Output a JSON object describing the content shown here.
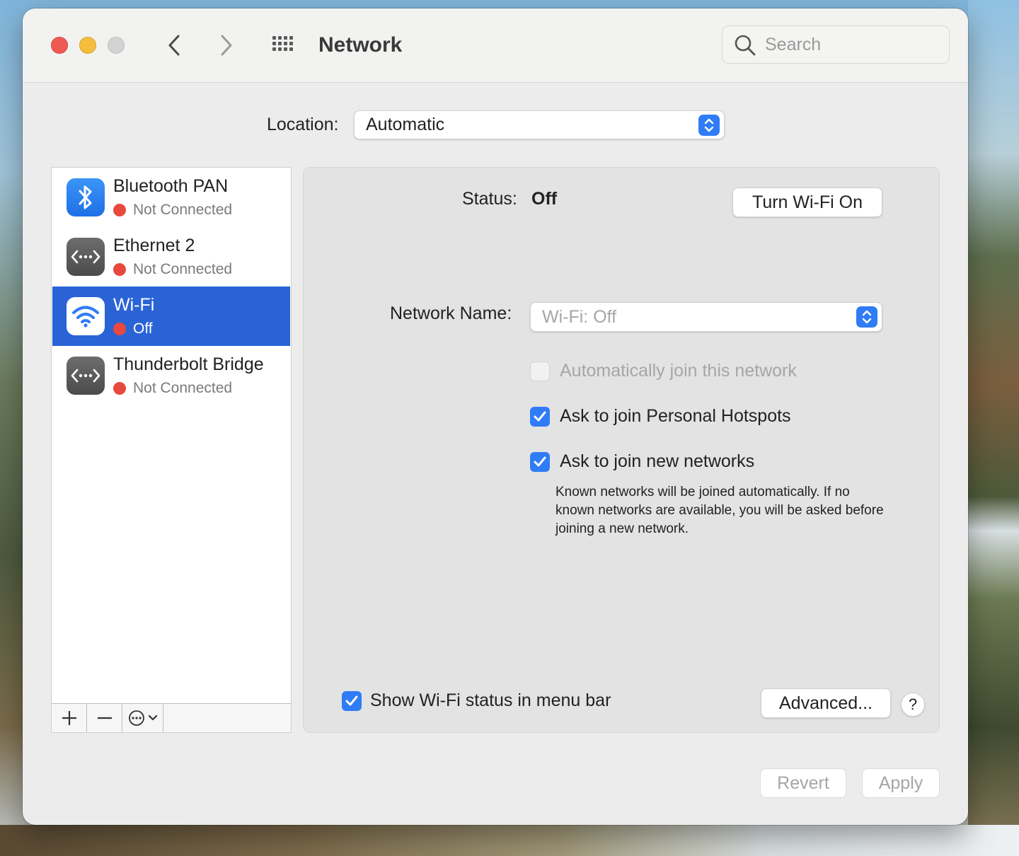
{
  "window": {
    "title": "Network",
    "search": {
      "placeholder": "Search",
      "value": ""
    }
  },
  "location": {
    "label": "Location:",
    "selected": "Automatic"
  },
  "services": [
    {
      "name": "Bluetooth PAN",
      "status": "Not Connected",
      "icon": "bluetooth-icon",
      "status_color": "#e8493e",
      "selected": false
    },
    {
      "name": "Ethernet 2",
      "status": "Not Connected",
      "icon": "ethernet-icon",
      "status_color": "#e8493e",
      "selected": false
    },
    {
      "name": "Wi-Fi",
      "status": "Off",
      "icon": "wifi-icon",
      "status_color": "#e8493e",
      "selected": true
    },
    {
      "name": "Thunderbolt Bridge",
      "status": "Not Connected",
      "icon": "ethernet-icon",
      "status_color": "#e8493e",
      "selected": false
    }
  ],
  "sidebar_toolbar": {
    "add": "+",
    "remove": "—"
  },
  "detail": {
    "status_label": "Status:",
    "status_value": "Off",
    "turn_on_button": "Turn Wi-Fi On",
    "network_name_label": "Network Name:",
    "network_name_value": "Wi-Fi: Off",
    "options": [
      {
        "label": "Automatically join this network",
        "checked": false,
        "disabled": true
      },
      {
        "label": "Ask to join Personal Hotspots",
        "checked": true,
        "disabled": false
      },
      {
        "label": "Ask to join new networks",
        "checked": true,
        "disabled": false
      }
    ],
    "help_text": "Known networks will be joined automatically. If no known networks are available, you will be asked before joining a new network.",
    "show_status_label": "Show Wi-Fi status in menu bar",
    "show_status_checked": true,
    "advanced_button": "Advanced...",
    "help_button": "?"
  },
  "footer": {
    "revert": "Revert",
    "apply": "Apply"
  },
  "colors": {
    "accent": "#2f7cf6",
    "selection": "#2a63d6",
    "status_red": "#e8493e"
  }
}
